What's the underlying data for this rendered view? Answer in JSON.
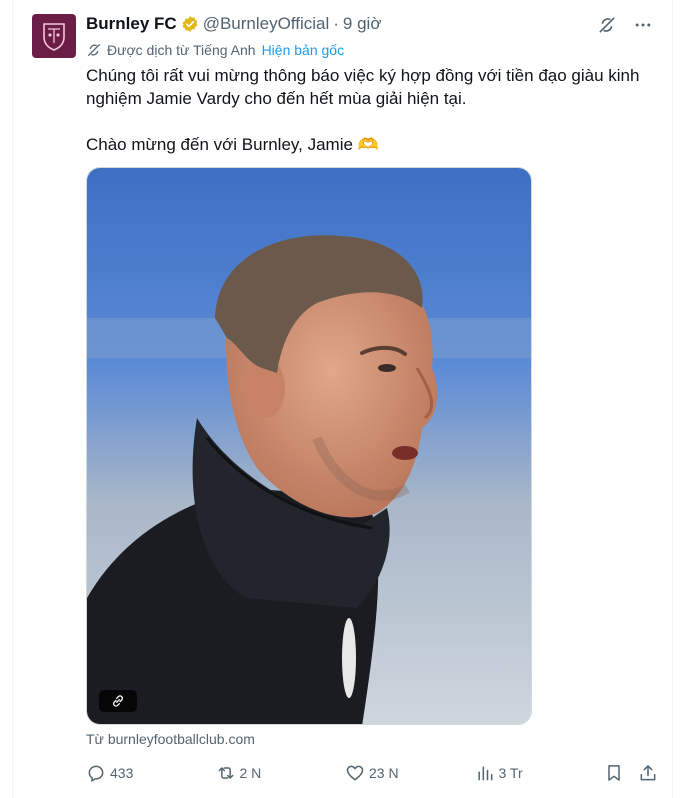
{
  "post": {
    "author_name": "Burnley FC",
    "handle": "@BurnleyOfficial",
    "separator": "·",
    "time": "9 giờ",
    "translation": {
      "note": "Được dịch từ Tiếng Anh",
      "show_original": "Hiện bản gốc"
    },
    "text_line1": "Chúng tôi rất vui mừng thông báo việc ký hợp đồng với tiền đạo giàu kinh nghiệm Jamie Vardy cho đến hết mùa giải hiện tại.",
    "text_line2": "Chào mừng đến với Burnley, Jamie 🫶",
    "source": "Từ burnleyfootballclub.com",
    "stats": {
      "replies": "433",
      "reposts": "2 N",
      "likes": "23 N",
      "views": "3 Tr"
    }
  },
  "icons": {
    "verified": "gold-verified-badge-icon",
    "grok": "grok-icon",
    "more": "more-dots-icon",
    "translate": "translate-icon",
    "link": "link-icon",
    "reply": "reply-icon",
    "repost": "repost-icon",
    "like": "heart-icon",
    "views": "views-icon",
    "bookmark": "bookmark-icon",
    "share": "share-icon"
  },
  "colors": {
    "brand_claret": "#6c1d45",
    "link_blue": "#1d9bf0",
    "verified_gold": "#e2b719",
    "muted_text": "#536471"
  }
}
